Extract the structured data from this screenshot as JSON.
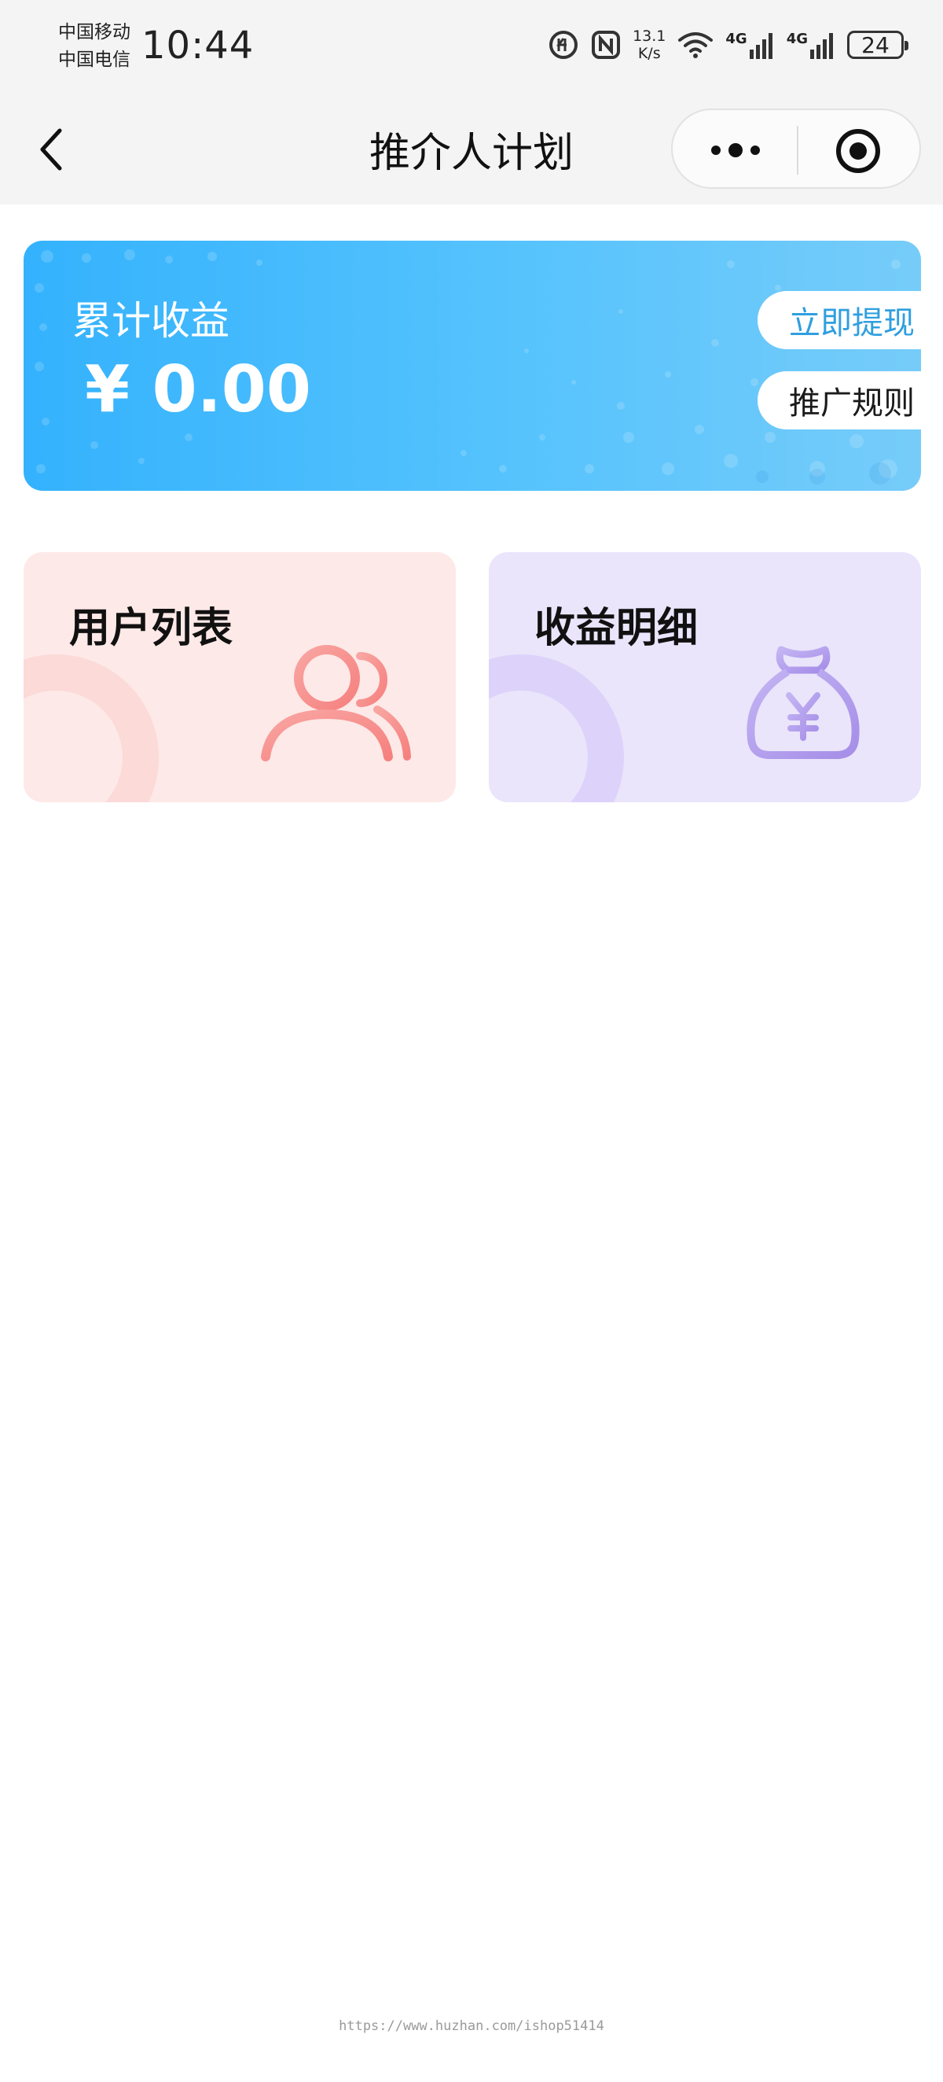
{
  "status_bar": {
    "carrier_1": "中国移动",
    "carrier_2": "中国电信",
    "time": "10:44",
    "net_speed_value": "13.1",
    "net_speed_unit": "K/s",
    "sim1_network": "4G",
    "sim2_network": "4G",
    "battery_level": "24",
    "icons": [
      "hd-call-icon",
      "nfc-icon",
      "wifi-icon",
      "signal-icon",
      "signal-icon",
      "battery-icon"
    ]
  },
  "nav": {
    "title": "推介人计划",
    "back_icon": "chevron-left-icon",
    "more_icon": "more-dots-icon",
    "close_icon": "target-circle-icon"
  },
  "earnings": {
    "label": "累计收益",
    "amount": "¥ 0.00",
    "withdraw_label": "立即提现",
    "rules_label": "推广规则",
    "colors": {
      "gradient_start": "#34b2fd",
      "gradient_end": "#76ccf9",
      "withdraw_text": "#2f9fdf"
    }
  },
  "features": {
    "user_list": {
      "title": "用户列表",
      "icon": "users-icon",
      "color": "#fde9e7"
    },
    "income_detail": {
      "title": "收益明细",
      "icon": "money-bag-yen-icon",
      "color": "#eae5fb"
    }
  },
  "footer": {
    "watermark": "https://www.huzhan.com/ishop51414"
  }
}
